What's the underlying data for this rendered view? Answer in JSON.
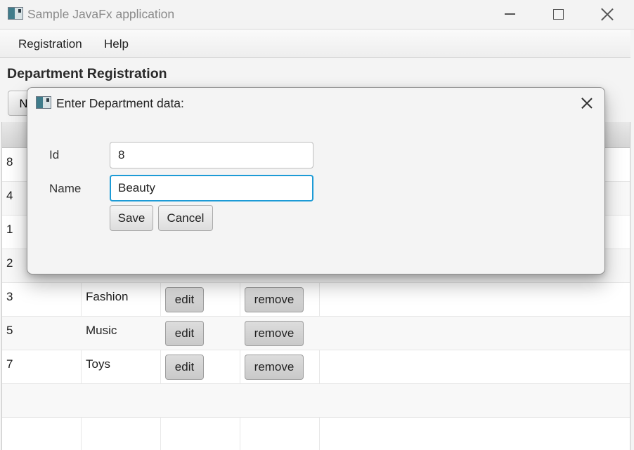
{
  "window": {
    "title": "Sample JavaFx application",
    "icon": "java-window-icon"
  },
  "menu": {
    "items": [
      "Registration",
      "Help"
    ]
  },
  "page": {
    "title": "Department Registration",
    "new_button": "Ne"
  },
  "table": {
    "rows": [
      {
        "id": "8",
        "name": "",
        "edit": "",
        "remove": ""
      },
      {
        "id": "4",
        "name": "",
        "edit": "",
        "remove": ""
      },
      {
        "id": "1",
        "name": "",
        "edit": "",
        "remove": ""
      },
      {
        "id": "2",
        "name": "",
        "edit": "",
        "remove": ""
      },
      {
        "id": "3",
        "name": "Fashion",
        "edit": "edit",
        "remove": "remove"
      },
      {
        "id": "5",
        "name": "Music",
        "edit": "edit",
        "remove": "remove"
      },
      {
        "id": "7",
        "name": "Toys",
        "edit": "edit",
        "remove": "remove"
      }
    ]
  },
  "dialog": {
    "title": "Enter Department data:",
    "fields": {
      "id_label": "Id",
      "id_value": "8",
      "name_label": "Name",
      "name_value": "Beauty"
    },
    "buttons": {
      "save": "Save",
      "cancel": "Cancel"
    }
  },
  "colors": {
    "focus_accent": "#1d9bd6",
    "window_background": "#f4f4f4"
  }
}
